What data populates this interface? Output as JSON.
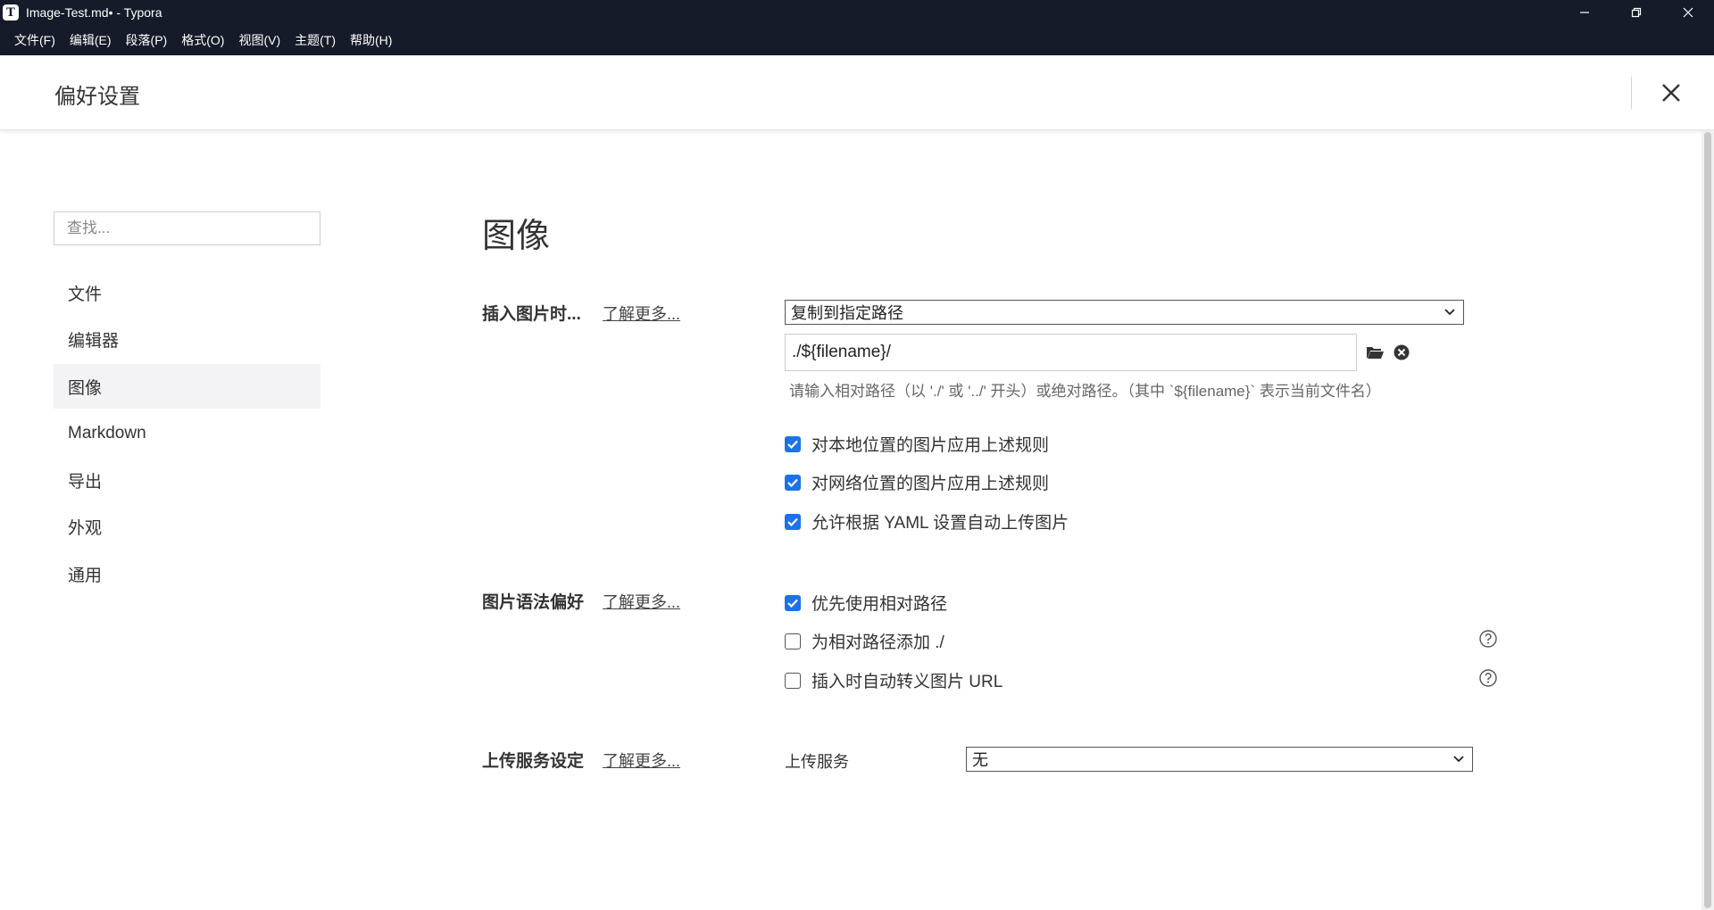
{
  "window": {
    "title": "Image-Test.md• - Typora",
    "app_icon": "T"
  },
  "menu": [
    "文件(F)",
    "编辑(E)",
    "段落(P)",
    "格式(O)",
    "视图(V)",
    "主题(T)",
    "帮助(H)"
  ],
  "preferences": {
    "title": "偏好设置"
  },
  "sidebar": {
    "search_placeholder": "查找...",
    "items": [
      {
        "label": "文件"
      },
      {
        "label": "编辑器"
      },
      {
        "label": "图像",
        "active": true
      },
      {
        "label": "Markdown"
      },
      {
        "label": "导出"
      },
      {
        "label": "外观"
      },
      {
        "label": "通用"
      }
    ]
  },
  "main": {
    "section_title": "图像",
    "learn_more": "了解更多...",
    "insert": {
      "label": "插入图片时...",
      "action_value": "复制到指定路径",
      "path_value": "./${filename}/",
      "hint": "请输入相对路径（以 './' 或 '../' 开头）或绝对路径。（其中 `${filename}` 表示当前文件名）",
      "options": [
        {
          "label": "对本地位置的图片应用上述规则",
          "checked": true
        },
        {
          "label": "对网络位置的图片应用上述规则",
          "checked": true
        },
        {
          "label": "允许根据 YAML 设置自动上传图片",
          "checked": true
        }
      ]
    },
    "syntax": {
      "label": "图片语法偏好",
      "options": [
        {
          "label": "优先使用相对路径",
          "checked": true
        },
        {
          "label": "为相对路径添加 ./",
          "checked": false
        },
        {
          "label": "插入时自动转义图片 URL",
          "checked": false
        }
      ]
    },
    "upload": {
      "label": "上传服务设定",
      "service_label": "上传服务",
      "service_value": "无"
    }
  },
  "colors": {
    "titlebar": "#151b28",
    "checkbox_accent": "#1a73e8"
  }
}
